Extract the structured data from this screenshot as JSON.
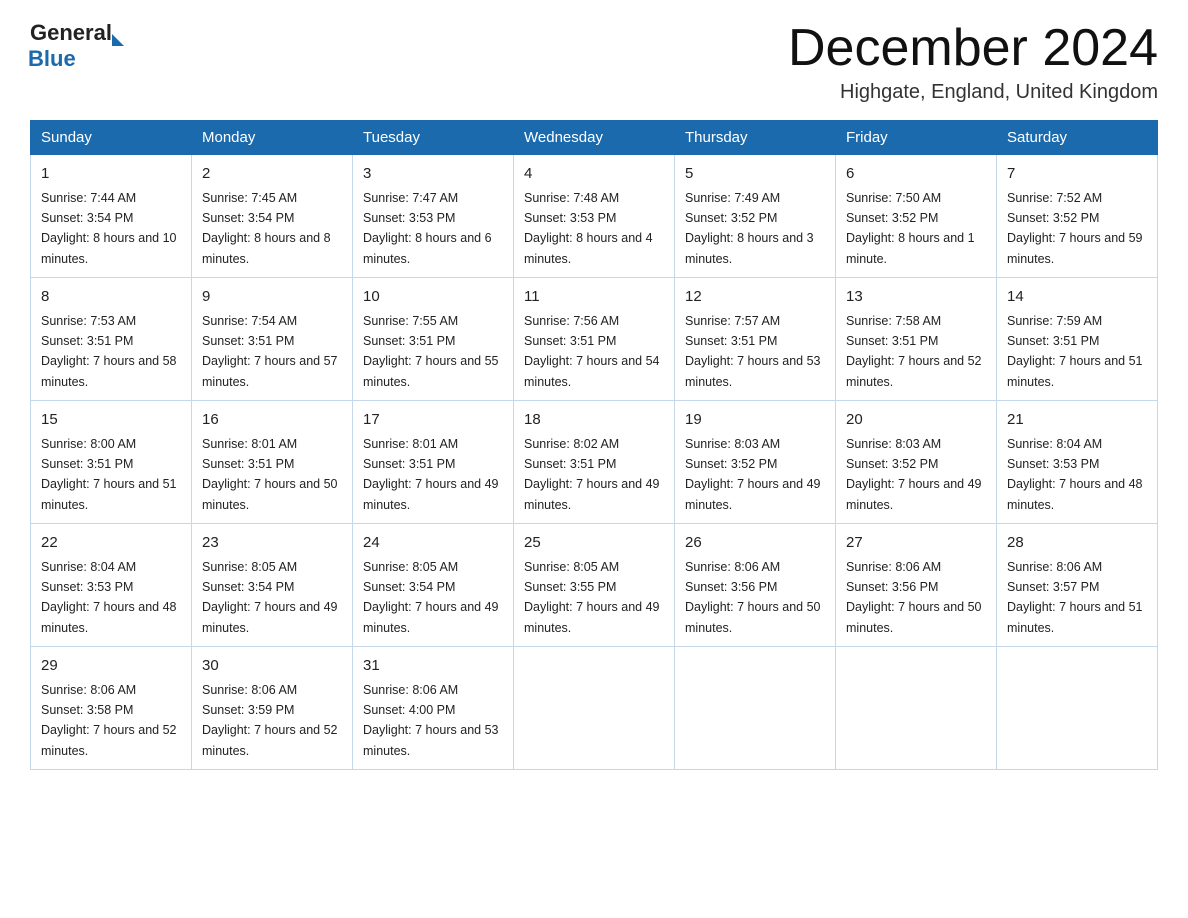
{
  "header": {
    "logo_general": "General",
    "logo_blue": "Blue",
    "month_title": "December 2024",
    "location": "Highgate, England, United Kingdom"
  },
  "weekdays": [
    "Sunday",
    "Monday",
    "Tuesday",
    "Wednesday",
    "Thursday",
    "Friday",
    "Saturday"
  ],
  "weeks": [
    [
      {
        "day": "1",
        "sunrise": "7:44 AM",
        "sunset": "3:54 PM",
        "daylight": "8 hours and 10 minutes."
      },
      {
        "day": "2",
        "sunrise": "7:45 AM",
        "sunset": "3:54 PM",
        "daylight": "8 hours and 8 minutes."
      },
      {
        "day": "3",
        "sunrise": "7:47 AM",
        "sunset": "3:53 PM",
        "daylight": "8 hours and 6 minutes."
      },
      {
        "day": "4",
        "sunrise": "7:48 AM",
        "sunset": "3:53 PM",
        "daylight": "8 hours and 4 minutes."
      },
      {
        "day": "5",
        "sunrise": "7:49 AM",
        "sunset": "3:52 PM",
        "daylight": "8 hours and 3 minutes."
      },
      {
        "day": "6",
        "sunrise": "7:50 AM",
        "sunset": "3:52 PM",
        "daylight": "8 hours and 1 minute."
      },
      {
        "day": "7",
        "sunrise": "7:52 AM",
        "sunset": "3:52 PM",
        "daylight": "7 hours and 59 minutes."
      }
    ],
    [
      {
        "day": "8",
        "sunrise": "7:53 AM",
        "sunset": "3:51 PM",
        "daylight": "7 hours and 58 minutes."
      },
      {
        "day": "9",
        "sunrise": "7:54 AM",
        "sunset": "3:51 PM",
        "daylight": "7 hours and 57 minutes."
      },
      {
        "day": "10",
        "sunrise": "7:55 AM",
        "sunset": "3:51 PM",
        "daylight": "7 hours and 55 minutes."
      },
      {
        "day": "11",
        "sunrise": "7:56 AM",
        "sunset": "3:51 PM",
        "daylight": "7 hours and 54 minutes."
      },
      {
        "day": "12",
        "sunrise": "7:57 AM",
        "sunset": "3:51 PM",
        "daylight": "7 hours and 53 minutes."
      },
      {
        "day": "13",
        "sunrise": "7:58 AM",
        "sunset": "3:51 PM",
        "daylight": "7 hours and 52 minutes."
      },
      {
        "day": "14",
        "sunrise": "7:59 AM",
        "sunset": "3:51 PM",
        "daylight": "7 hours and 51 minutes."
      }
    ],
    [
      {
        "day": "15",
        "sunrise": "8:00 AM",
        "sunset": "3:51 PM",
        "daylight": "7 hours and 51 minutes."
      },
      {
        "day": "16",
        "sunrise": "8:01 AM",
        "sunset": "3:51 PM",
        "daylight": "7 hours and 50 minutes."
      },
      {
        "day": "17",
        "sunrise": "8:01 AM",
        "sunset": "3:51 PM",
        "daylight": "7 hours and 49 minutes."
      },
      {
        "day": "18",
        "sunrise": "8:02 AM",
        "sunset": "3:51 PM",
        "daylight": "7 hours and 49 minutes."
      },
      {
        "day": "19",
        "sunrise": "8:03 AM",
        "sunset": "3:52 PM",
        "daylight": "7 hours and 49 minutes."
      },
      {
        "day": "20",
        "sunrise": "8:03 AM",
        "sunset": "3:52 PM",
        "daylight": "7 hours and 49 minutes."
      },
      {
        "day": "21",
        "sunrise": "8:04 AM",
        "sunset": "3:53 PM",
        "daylight": "7 hours and 48 minutes."
      }
    ],
    [
      {
        "day": "22",
        "sunrise": "8:04 AM",
        "sunset": "3:53 PM",
        "daylight": "7 hours and 48 minutes."
      },
      {
        "day": "23",
        "sunrise": "8:05 AM",
        "sunset": "3:54 PM",
        "daylight": "7 hours and 49 minutes."
      },
      {
        "day": "24",
        "sunrise": "8:05 AM",
        "sunset": "3:54 PM",
        "daylight": "7 hours and 49 minutes."
      },
      {
        "day": "25",
        "sunrise": "8:05 AM",
        "sunset": "3:55 PM",
        "daylight": "7 hours and 49 minutes."
      },
      {
        "day": "26",
        "sunrise": "8:06 AM",
        "sunset": "3:56 PM",
        "daylight": "7 hours and 50 minutes."
      },
      {
        "day": "27",
        "sunrise": "8:06 AM",
        "sunset": "3:56 PM",
        "daylight": "7 hours and 50 minutes."
      },
      {
        "day": "28",
        "sunrise": "8:06 AM",
        "sunset": "3:57 PM",
        "daylight": "7 hours and 51 minutes."
      }
    ],
    [
      {
        "day": "29",
        "sunrise": "8:06 AM",
        "sunset": "3:58 PM",
        "daylight": "7 hours and 52 minutes."
      },
      {
        "day": "30",
        "sunrise": "8:06 AM",
        "sunset": "3:59 PM",
        "daylight": "7 hours and 52 minutes."
      },
      {
        "day": "31",
        "sunrise": "8:06 AM",
        "sunset": "4:00 PM",
        "daylight": "7 hours and 53 minutes."
      },
      null,
      null,
      null,
      null
    ]
  ]
}
